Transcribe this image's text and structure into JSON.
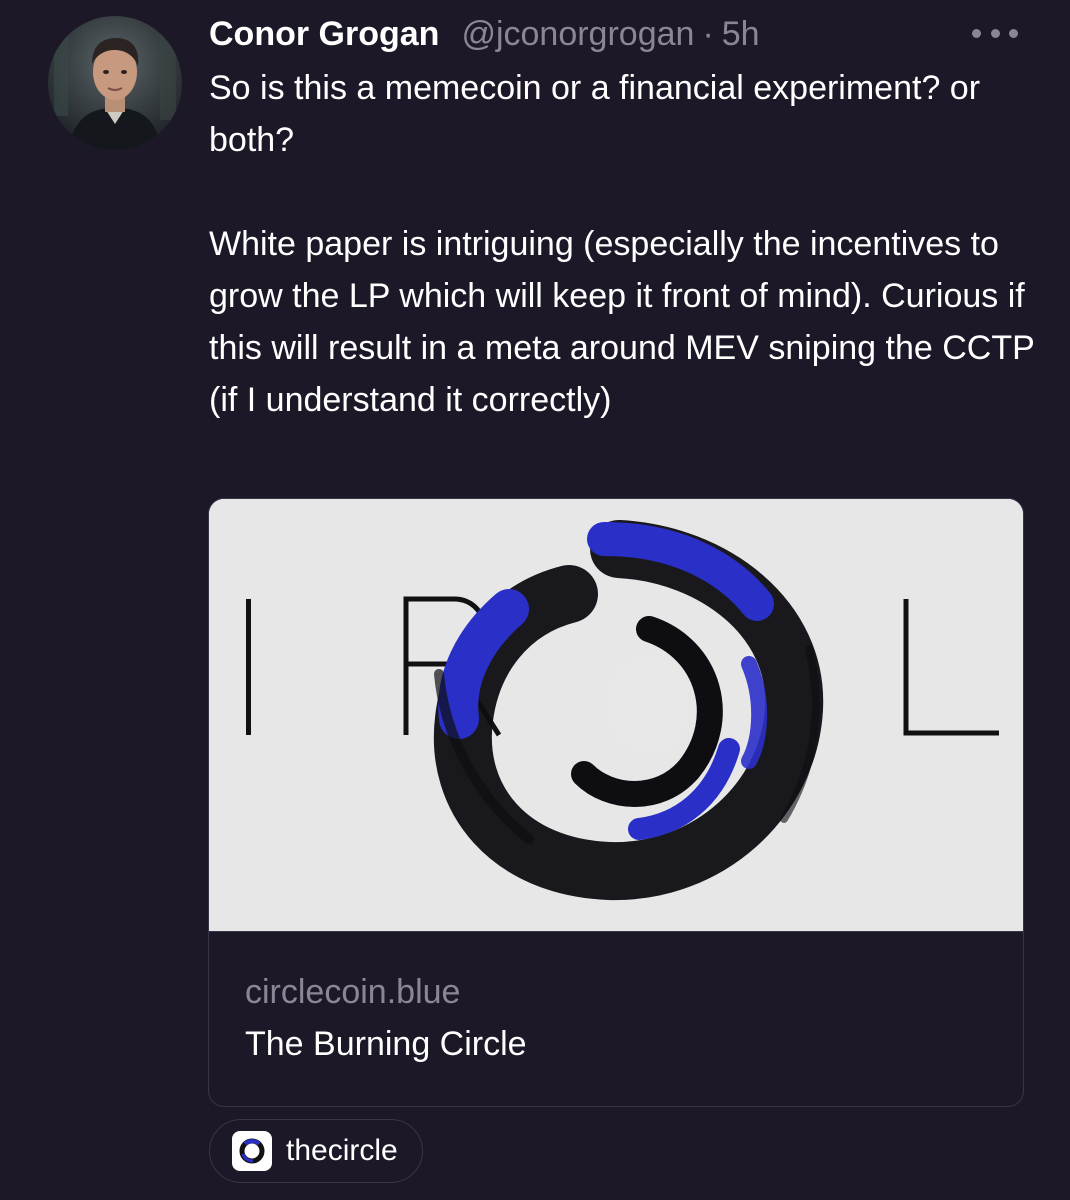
{
  "tweet": {
    "author_name": "Conor Grogan",
    "handle": "@jconorgrogan",
    "separator": "·",
    "time": "5h",
    "paragraphs": [
      "So is this a memecoin or a financial experiment? or both?",
      "White paper is intriguing (especially the incentives to grow the LP which will keep it front of mind). Curious if this will result in a meta around MEV sniping the CCTP (if I understand it correctly)"
    ]
  },
  "link_card": {
    "domain": "circlecoin.blue",
    "title": "The Burning Circle",
    "image_letters": [
      "I",
      "R",
      "L"
    ]
  },
  "tag": {
    "label": "thecircle",
    "icon": "circle-logo-icon"
  },
  "icons": {
    "more": "more-options-icon",
    "avatar": "avatar"
  },
  "colors": {
    "background": "#1d1827",
    "text_primary": "#ffffff",
    "text_secondary": "#8b8598",
    "border": "#3a3448",
    "logo_blue": "#2a2fc8"
  }
}
